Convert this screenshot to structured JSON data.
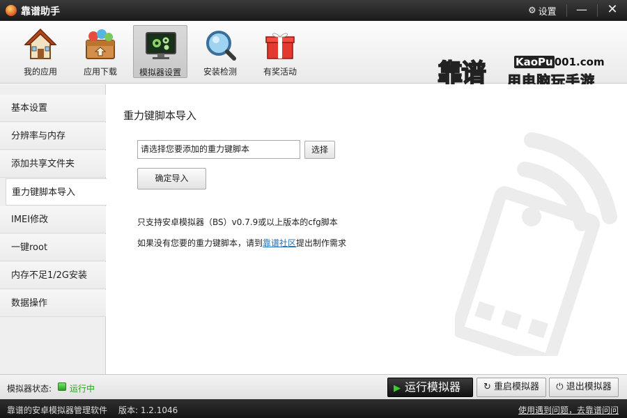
{
  "window": {
    "title": "靠谱助手",
    "settings_label": "设置",
    "minimize_icon": "minimize-icon",
    "close_icon": "close-icon"
  },
  "toolbar": {
    "items": [
      {
        "label": "我的应用",
        "icon": "house-icon"
      },
      {
        "label": "应用下载",
        "icon": "download-box-icon"
      },
      {
        "label": "模拟器设置",
        "icon": "monitor-gears-icon",
        "active": true
      },
      {
        "label": "安装检测",
        "icon": "magnifier-icon"
      },
      {
        "label": "有奖活动",
        "icon": "gift-icon"
      }
    ]
  },
  "brand": {
    "name": "靠谱",
    "url_prefix": "KaoPu",
    "url_suffix": "001.com",
    "slogan": "用电脑玩手游"
  },
  "sidebar": {
    "items": [
      {
        "label": "基本设置"
      },
      {
        "label": "分辨率与内存"
      },
      {
        "label": "添加共享文件夹"
      },
      {
        "label": "重力键脚本导入",
        "active": true
      },
      {
        "label": "IMEI修改"
      },
      {
        "label": "一键root"
      },
      {
        "label": "内存不足1/2G安装"
      },
      {
        "label": "数据操作"
      }
    ]
  },
  "main": {
    "title": "重力键脚本导入",
    "file_input_value": "请选择您要添加的重力键脚本",
    "choose_label": "选择",
    "confirm_label": "确定导入",
    "note1": "只支持安卓模拟器（BS）v0.7.9或以上版本的cfg脚本",
    "note2_prefix": "如果没有您要的重力键脚本，请到",
    "note2_link": "靠谱社区",
    "note2_suffix": "提出制作需求"
  },
  "status": {
    "label": "模拟器状态:",
    "value": "运行中",
    "color": "#2a9f25",
    "run_label": "运行模拟器",
    "restart_label": "重启模拟器",
    "exit_label": "退出模拟器"
  },
  "footer": {
    "app_desc": "靠谱的安卓模拟器管理软件",
    "version": "版本: 1.2.1046",
    "help_link": "使用遇到问题，去靠谱问问"
  },
  "colors": {
    "accent_orange": "#f07c10",
    "titlebar": "#2a2a2a",
    "link": "#1a6fc0"
  }
}
